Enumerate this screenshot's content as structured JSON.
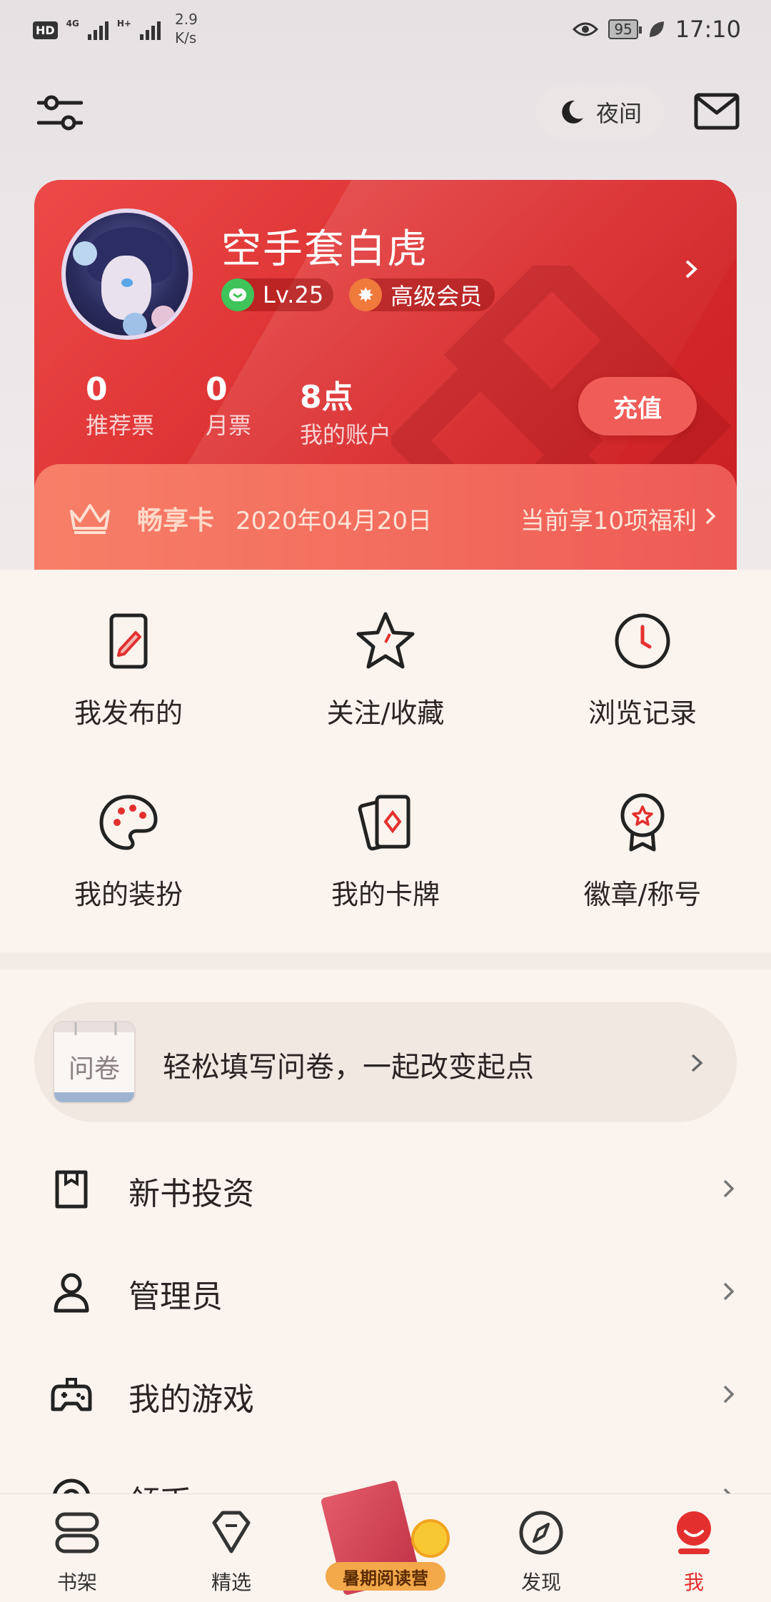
{
  "status_bar": {
    "hd": "HD",
    "net1": "4G",
    "net2": "H+",
    "speed_value": "2.9",
    "speed_unit": "K/s",
    "battery": "95",
    "time": "17:10"
  },
  "header": {
    "night_label": "夜间"
  },
  "profile": {
    "username": "空手套白虎",
    "level": "Lv.25",
    "vip_label": "高级会员",
    "stats": [
      {
        "value": "0",
        "label": "推荐票"
      },
      {
        "value": "0",
        "label": "月票"
      },
      {
        "value": "8点",
        "label": "我的账户"
      }
    ],
    "recharge_label": "充值"
  },
  "vip_card": {
    "name": "畅享卡",
    "date": "2020年04月20日",
    "benefit": "当前享10项福利"
  },
  "grid": [
    {
      "label": "我发布的",
      "icon": "edit-icon"
    },
    {
      "label": "关注/收藏",
      "icon": "star-icon"
    },
    {
      "label": "浏览记录",
      "icon": "clock-icon"
    },
    {
      "label": "我的装扮",
      "icon": "palette-icon"
    },
    {
      "label": "我的卡牌",
      "icon": "cards-icon"
    },
    {
      "label": "徽章/称号",
      "icon": "badge-icon"
    }
  ],
  "survey": {
    "icon_text": "问卷",
    "text": "轻松填写问卷，一起改变起点"
  },
  "list": [
    {
      "label": "新书投资",
      "icon": "bookmark-icon"
    },
    {
      "label": "管理员",
      "icon": "user-icon"
    },
    {
      "label": "我的游戏",
      "icon": "gamepad-icon"
    },
    {
      "label": "领币",
      "icon": "coin-icon"
    }
  ],
  "tabs": [
    {
      "label": "书架",
      "icon": "bookshelf-icon"
    },
    {
      "label": "精选",
      "icon": "diamond-icon"
    },
    {
      "label": "暑期阅读营",
      "icon": "reading-camp-icon"
    },
    {
      "label": "发现",
      "icon": "compass-icon"
    },
    {
      "label": "我",
      "icon": "profile-icon"
    }
  ],
  "colors": {
    "accent": "#e3302f",
    "card_red": "#d92a2c",
    "background": "#fbf3ee"
  }
}
